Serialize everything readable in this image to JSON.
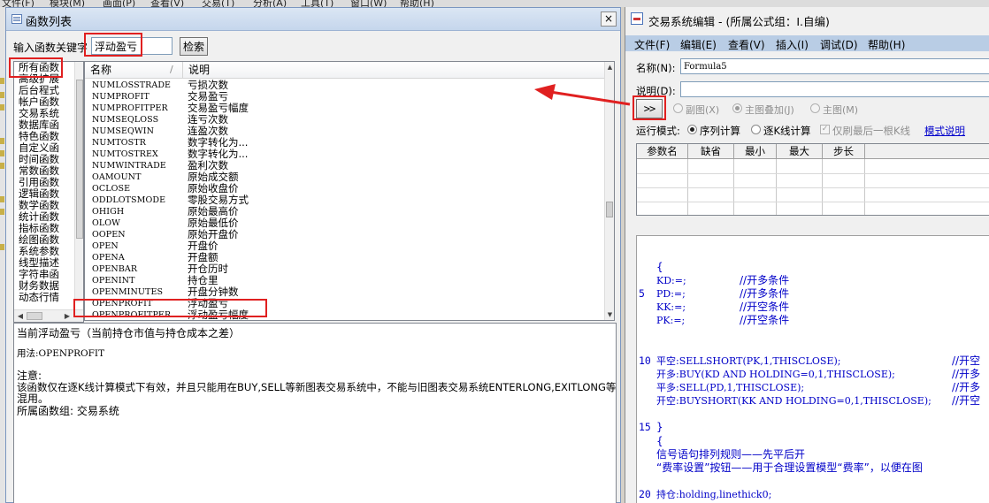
{
  "top_menu": [
    "文件(F)",
    "模块(M)",
    "画面(P)",
    "查看(V)",
    "交易(T)",
    "分析(A)",
    "工具(T)",
    "窗口(W)",
    "帮助(H)"
  ],
  "function_list": {
    "title": "函数列表",
    "close_glyph": "×",
    "keyword_label": "输入函数关键字",
    "keyword_value": "浮动盈亏",
    "search_label": "检索",
    "categories": [
      "所有函数",
      "高级扩展",
      "后台程式",
      "帐户函数",
      "交易系统",
      "数据库函",
      "特色函数",
      "自定义函",
      "时间函数",
      "常数函数",
      "引用函数",
      "逻辑函数",
      "数学函数",
      "统计函数",
      "指标函数",
      "绘图函数",
      "系统参数",
      "线型描述",
      "字符串函",
      "财务数据",
      "动态行情"
    ],
    "columns": {
      "name": "名称",
      "desc": "说明"
    },
    "rows": [
      {
        "name": "NUMLOSSTRADE",
        "desc": "亏损次数"
      },
      {
        "name": "NUMPROFIT",
        "desc": "交易盈亏"
      },
      {
        "name": "NUMPROFITPER",
        "desc": "交易盈亏幅度"
      },
      {
        "name": "NUMSEQLOSS",
        "desc": "连亏次数"
      },
      {
        "name": "NUMSEQWIN",
        "desc": "连盈次数"
      },
      {
        "name": "NUMTOSTR",
        "desc": "数字转化为..."
      },
      {
        "name": "NUMTOSTREX",
        "desc": "数字转化为..."
      },
      {
        "name": "NUMWINTRADE",
        "desc": "盈利次数"
      },
      {
        "name": "OAMOUNT",
        "desc": "原始成交额"
      },
      {
        "name": "OCLOSE",
        "desc": "原始收盘价"
      },
      {
        "name": "ODDLOTSMODE",
        "desc": "零股交易方式"
      },
      {
        "name": "OHIGH",
        "desc": "原始最高价"
      },
      {
        "name": "OLOW",
        "desc": "原始最低价"
      },
      {
        "name": "OOPEN",
        "desc": "原始开盘价"
      },
      {
        "name": "OPEN",
        "desc": "开盘价"
      },
      {
        "name": "OPENA",
        "desc": "开盘额"
      },
      {
        "name": "OPENBAR",
        "desc": "开仓历时"
      },
      {
        "name": "OPENINT",
        "desc": "持仓里"
      },
      {
        "name": "OPENMINUTES",
        "desc": "开盘分钟数"
      },
      {
        "name": "OPENPROFIT",
        "desc": "浮动盈亏"
      },
      {
        "name": "OPENPROFITPER",
        "desc": "浮动盈亏幅度"
      }
    ],
    "description": {
      "summary": "当前浮动盈亏（当前持仓市值与持仓成本之差）",
      "usage": "用法:OPENPROFIT",
      "note_title": "注意:",
      "note_line1": "该函数仅在逐K线计算模式下有效，并且只能用在BUY,SELL等新图表交易系统中，不能与旧图表交易系统ENTERLONG,EXITLONG等",
      "note_line2": "混用。",
      "group": "所属函数组: 交易系统"
    }
  },
  "editor": {
    "title": "交易系统编辑 - (所属公式组：I.自编)",
    "menu": [
      "文件(F)",
      "编辑(E)",
      "查看(V)",
      "插入(I)",
      "调试(D)",
      "帮助(H)"
    ],
    "name_label": "名称(N):",
    "name_value": "Formula5",
    "desc_label": "说明(D):",
    "desc_value": "",
    "arrow_button": ">>",
    "chart_modes": [
      "副图(X)",
      "主图叠加(J)",
      "主图(M)"
    ],
    "run_mode_label": "运行模式:",
    "run_modes": [
      "序列计算",
      "逐K线计算"
    ],
    "last_bar_only": "仅刷最后一根K线",
    "mode_help": "模式说明",
    "param_columns": [
      "参数名",
      "缺省",
      "最小",
      "最大",
      "步长"
    ],
    "code_lines": [
      {
        "ln": "",
        "text": "{"
      },
      {
        "ln": "",
        "text": "KD:=;",
        "comment": "//开多条件"
      },
      {
        "ln": "5",
        "text": "PD:=;",
        "comment": "//开多条件"
      },
      {
        "ln": "",
        "text": "KK:=;",
        "comment": "//开空条件"
      },
      {
        "ln": "",
        "text": "PK:=;",
        "comment": "//开空条件"
      },
      {
        "ln": "",
        "text": ""
      },
      {
        "ln": "",
        "text": ""
      },
      {
        "ln": "10",
        "text": "平空:SELLSHORT(PK,1,THISCLOSE);",
        "comment": "//开空"
      },
      {
        "ln": "",
        "text": "开多:BUY(KD AND HOLDING=0,1,THISCLOSE);",
        "comment": "//开多"
      },
      {
        "ln": "",
        "text": "平多:SELL(PD,1,THISCLOSE);",
        "comment": "//开多"
      },
      {
        "ln": "",
        "text": "开空:BUYSHORT(KK AND HOLDING=0,1,THISCLOSE);",
        "comment": "//开空"
      },
      {
        "ln": "",
        "text": ""
      },
      {
        "ln": "15",
        "text": "}"
      },
      {
        "ln": "",
        "text": "{"
      },
      {
        "ln": "",
        "text": "信号语句排列规则——先平后开"
      },
      {
        "ln": "",
        "text": "“费率设置”按钮——用于合理设置模型“费率”，以便在图"
      },
      {
        "ln": "",
        "text": ""
      },
      {
        "ln": "20",
        "text": "持仓:holding,linethick0;"
      }
    ]
  }
}
